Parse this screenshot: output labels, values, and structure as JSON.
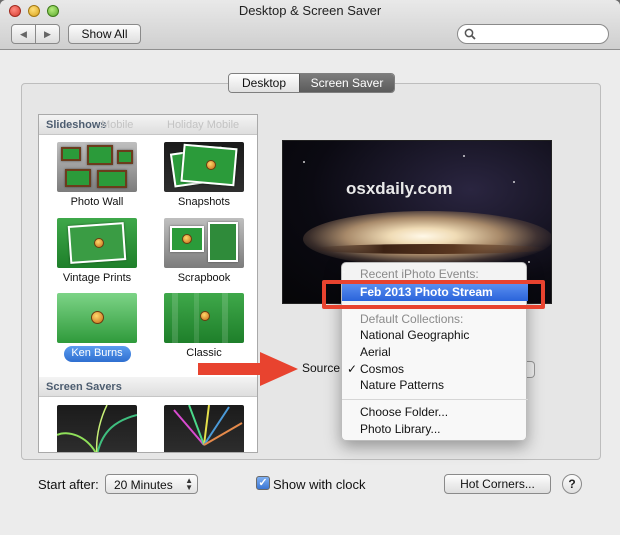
{
  "window": {
    "title": "Desktop & Screen Saver"
  },
  "toolbar": {
    "back_icon": "◀",
    "forward_icon": "▶",
    "show_all_label": "Show All",
    "search_placeholder": ""
  },
  "tabs": [
    {
      "label": "Desktop",
      "selected": false
    },
    {
      "label": "Screen Saver",
      "selected": true
    }
  ],
  "sidebar": {
    "slideshows_header": "Slideshows",
    "ghost_labels": [
      "Mobile",
      "Holiday Mobile"
    ],
    "slideshows": [
      {
        "label": "Photo Wall"
      },
      {
        "label": "Snapshots"
      },
      {
        "label": "Vintage Prints"
      },
      {
        "label": "Scrapbook"
      },
      {
        "label": "Ken Burns",
        "selected": true
      },
      {
        "label": "Classic"
      }
    ],
    "screensavers_header": "Screen Savers"
  },
  "preview": {
    "watermark": "osxdaily.com"
  },
  "source": {
    "label": "Source"
  },
  "source_menu": {
    "recent_header": "Recent iPhoto Events:",
    "highlighted_item": "Feb 2013 Photo Stream",
    "collections_header": "Default Collections:",
    "collections": [
      "National Geographic",
      "Aerial",
      "Cosmos",
      "Nature Patterns"
    ],
    "checked_item": "Cosmos",
    "check_mark": "✓",
    "actions": [
      "Choose Folder...",
      "Photo Library..."
    ]
  },
  "bottom": {
    "start_after_label": "Start after:",
    "start_after_value": "20 Minutes",
    "show_clock_label": "Show with clock",
    "show_clock_checked": true,
    "hot_corners_label": "Hot Corners...",
    "help_label": "?"
  },
  "colors": {
    "highlight": "#2a63da",
    "annotation_red": "#e8432f"
  }
}
